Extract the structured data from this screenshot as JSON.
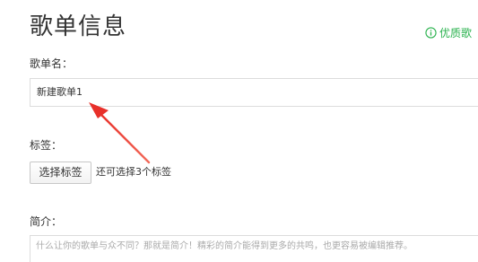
{
  "page": {
    "title": "歌单信息",
    "tip": {
      "icon": "info-circle-icon",
      "text": "优质歌",
      "color": "#2ab24e"
    }
  },
  "form": {
    "name": {
      "label": "歌单名：",
      "value": "新建歌单1"
    },
    "tags": {
      "label": "标签：",
      "button_label": "选择标签",
      "hint": "还可选择3个标签"
    },
    "intro": {
      "label": "简介：",
      "placeholder": "什么让你的歌单与众不同？那就是简介！精彩的简介能得到更多的共鸣，也更容易被编辑推荐。"
    }
  },
  "annotation": {
    "arrow_color": "#e8302a"
  }
}
